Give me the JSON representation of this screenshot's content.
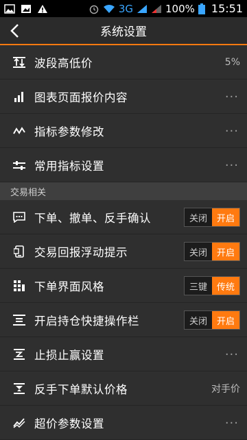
{
  "status": {
    "network": "3G",
    "battery": "100%",
    "time": "15:51"
  },
  "header": {
    "title": "系统设置"
  },
  "colors": {
    "accent": "#ff7a10",
    "background": "#2f2f2f",
    "section": "#3f3f3f"
  },
  "rows_top": [
    {
      "label": "波段高低价",
      "value": "5%",
      "icon": "band-high-low-icon"
    },
    {
      "label": "图表页面报价内容",
      "value": "···",
      "icon": "bar-chart-icon"
    },
    {
      "label": "指标参数修改",
      "value": "···",
      "icon": "line-wave-icon"
    },
    {
      "label": "常用指标设置",
      "value": "···",
      "icon": "sliders-icon"
    }
  ],
  "section_trade": "交易相关",
  "rows_trade": [
    {
      "label": "下单、撤单、反手确认",
      "icon": "chat-dots-icon",
      "toggle": {
        "left": "关闭",
        "right": "开启",
        "selected": "right"
      }
    },
    {
      "label": "交易回报浮动提示",
      "icon": "phone-notify-icon",
      "toggle": {
        "left": "关闭",
        "right": "开启",
        "selected": "right"
      }
    },
    {
      "label": "下单界面风格",
      "icon": "grid-style-icon",
      "toggle": {
        "left": "三键",
        "right": "传统",
        "selected": "right"
      }
    },
    {
      "label": "开启持仓快捷操作栏",
      "icon": "list-bars-icon",
      "toggle": {
        "left": "关闭",
        "right": "开启",
        "selected": "right"
      }
    },
    {
      "label": "止损止赢设置",
      "value": "···",
      "icon": "stop-loss-icon"
    },
    {
      "label": "反手下单默认价格",
      "value": "对手价",
      "icon": "reverse-order-icon"
    },
    {
      "label": "超价参数设置",
      "value": "···",
      "icon": "over-price-icon"
    }
  ]
}
